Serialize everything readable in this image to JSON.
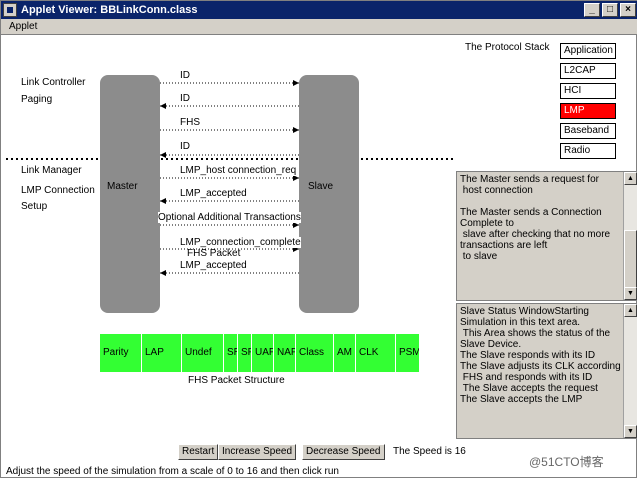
{
  "window": {
    "title": "Applet Viewer: BBLinkConn.class",
    "minimize": "_",
    "maximize": "□",
    "close": "×"
  },
  "menubar": {
    "applet": "Applet"
  },
  "left_labels": {
    "link_controller": "Link Controller",
    "paging": "Paging",
    "link_manager": "Link Manager",
    "lmp_connection": "LMP Connection",
    "setup": "Setup"
  },
  "devices": {
    "master": "Master",
    "slave": "Slave"
  },
  "messages": [
    "ID",
    "ID",
    "FHS",
    "ID",
    "LMP_host connection_req",
    "LMP_accepted",
    "Optional Additional Transactions",
    "LMP_connection_complete",
    "FHS Packet",
    "LMP_accepted"
  ],
  "protocol_stack": {
    "title": "The Protocol Stack",
    "layers": [
      "Application",
      "L2CAP",
      "HCI",
      "LMP",
      "Baseband",
      "Radio"
    ],
    "active": "LMP"
  },
  "packet": {
    "fields": [
      "Parity",
      "LAP",
      "Undef",
      "SR",
      "SP",
      "UAP",
      "NAP",
      "Class",
      "AM",
      "CLK",
      "PSM"
    ],
    "caption": "FHS Packet Structure"
  },
  "master_panel": {
    "text": "The Master sends a request for\n host connection\n\nThe Master sends a Connection\nComplete to\n slave after checking that no more\ntransactions are left\n to slave"
  },
  "slave_panel": {
    "text": "Slave Status WindowStarting\nSimulation in this text area.\n This Area shows the status of the\nSlave Device.\nThe Slave responds with its ID\nThe Slave adjusts its CLK according\n FHS and responds with its ID\n The Slave accepts the request\nThe Slave accepts the LMP"
  },
  "controls": {
    "restart": "Restart",
    "increase": "Increase Speed",
    "decrease": "Decrease Speed",
    "speed_text": "The Speed is 16"
  },
  "status_bar": "Adjust the speed of the simulation from a scale of 0 to 16 and then click run",
  "watermark": "@51CTO博客",
  "colors": {
    "device": "#8c8c8c",
    "packet": "#33ff33",
    "active_layer": "#ff0000",
    "titlebar": "#0a246a"
  }
}
